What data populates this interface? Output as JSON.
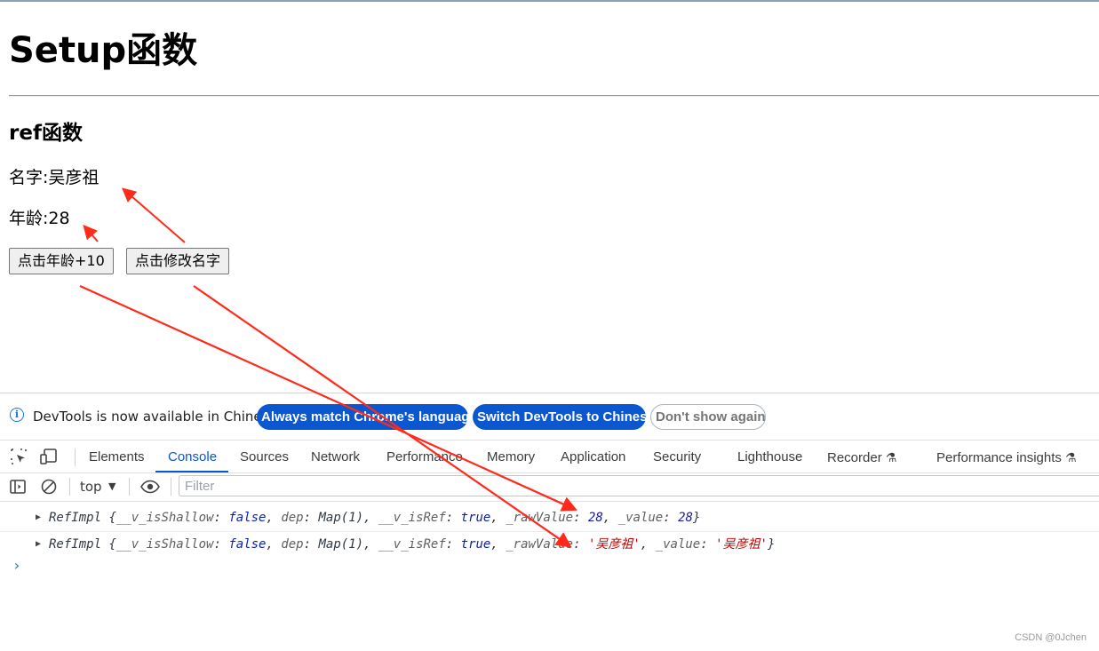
{
  "page": {
    "title": "Setup函数",
    "section_title": "ref函数",
    "name_label": "名字:",
    "name_value": "吴彦祖",
    "age_label": "年龄:",
    "age_value": "28",
    "btn_age": "点击年龄+10",
    "btn_name": "点击修改名字"
  },
  "devtools": {
    "infobar": {
      "message": "DevTools is now available in Chinese!",
      "btn_match": "Always match Chrome's language",
      "btn_switch": "Switch DevTools to Chinese",
      "btn_dismiss": "Don't show again"
    },
    "tabs": [
      "Elements",
      "Console",
      "Sources",
      "Network",
      "Performance",
      "Memory",
      "Application",
      "Security",
      "Lighthouse",
      "Recorder",
      "Performance insights"
    ],
    "active_tab": "Console",
    "toolbar": {
      "context": "top",
      "filter_placeholder": "Filter"
    },
    "logs": [
      {
        "class_name": "RefImpl",
        "is_shallow": "false",
        "dep": "Map(1)",
        "is_ref": "true",
        "raw_value": "28",
        "value": "28"
      },
      {
        "class_name": "RefImpl",
        "is_shallow": "false",
        "dep": "Map(1)",
        "is_ref": "true",
        "raw_value": "'吴彦祖'",
        "value": "'吴彦祖'"
      }
    ]
  },
  "colors": {
    "accent": "#0b57d0",
    "annotation": "#ff2a1a"
  },
  "watermark": "CSDN @0Jchen"
}
